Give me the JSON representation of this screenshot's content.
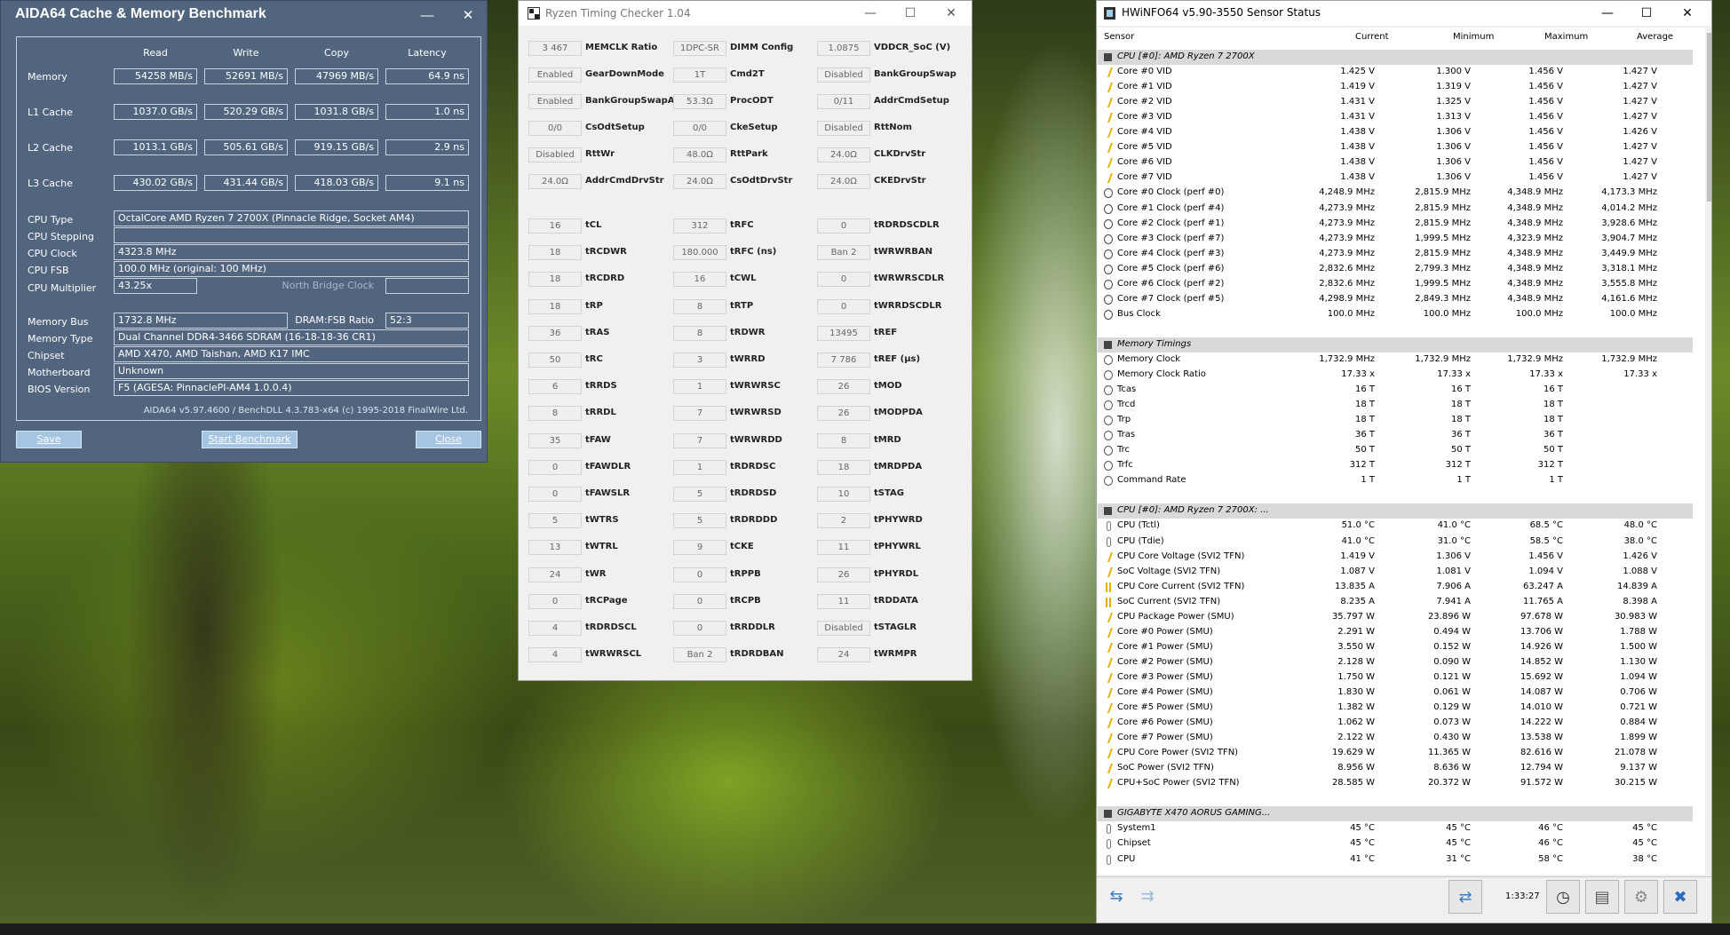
{
  "aida": {
    "title": "AIDA64 Cache & Memory Benchmark",
    "columns": [
      "Read",
      "Write",
      "Copy",
      "Latency"
    ],
    "rows": [
      {
        "label": "Memory",
        "values": [
          "54258 MB/s",
          "52691 MB/s",
          "47969 MB/s",
          "64.9 ns"
        ]
      },
      {
        "label": "L1 Cache",
        "values": [
          "1037.0 GB/s",
          "520.29 GB/s",
          "1031.8 GB/s",
          "1.0 ns"
        ]
      },
      {
        "label": "L2 Cache",
        "values": [
          "1013.1 GB/s",
          "505.61 GB/s",
          "919.15 GB/s",
          "2.9 ns"
        ]
      },
      {
        "label": "L3 Cache",
        "values": [
          "430.02 GB/s",
          "431.44 GB/s",
          "418.03 GB/s",
          "9.1 ns"
        ]
      }
    ],
    "cpu_type_label": "CPU Type",
    "cpu_type": "OctalCore AMD Ryzen 7 2700X  (Pinnacle Ridge, Socket AM4)",
    "cpu_stepping_label": "CPU Stepping",
    "cpu_stepping": "",
    "cpu_clock_label": "CPU Clock",
    "cpu_clock": "4323.8 MHz",
    "cpu_fsb_label": "CPU FSB",
    "cpu_fsb": "100.0 MHz  (original: 100 MHz)",
    "cpu_multiplier_label": "CPU Multiplier",
    "cpu_multiplier": "43.25x",
    "nb_clock_label": "North Bridge Clock",
    "nb_clock": "",
    "memory_bus_label": "Memory Bus",
    "memory_bus": "1732.8 MHz",
    "dram_fsb_label": "DRAM:FSB Ratio",
    "dram_fsb": "52:3",
    "memory_type_label": "Memory Type",
    "memory_type": "Dual Channel DDR4-3466 SDRAM  (16-18-18-36 CR1)",
    "chipset_label": "Chipset",
    "chipset": "AMD X470, AMD Taishan, AMD K17 IMC",
    "motherboard_label": "Motherboard",
    "motherboard": "Unknown",
    "bios_label": "BIOS Version",
    "bios": "F5  (AGESA: PinnaclePI-AM4 1.0.0.4)",
    "footer": "AIDA64 v5.97.4600 / BenchDLL 4.3.783-x64  (c) 1995-2018 FinalWire Ltd.",
    "save_label": "Save",
    "start_label": "Start Benchmark",
    "close_label": "Close"
  },
  "rtc": {
    "title": "Ryzen Timing Checker 1.04",
    "col1": [
      {
        "v": "3 467",
        "n": "MEMCLK Ratio"
      },
      {
        "v": "Enabled",
        "n": "GearDownMode"
      },
      {
        "v": "Enabled",
        "n": "BankGroupSwapAlt"
      },
      {
        "v": "0/0",
        "n": "CsOdtSetup"
      },
      {
        "v": "Disabled",
        "n": "RttWr"
      },
      {
        "v": "24.0Ω",
        "n": "AddrCmdDrvStr"
      },
      {
        "v": "16",
        "n": "tCL"
      },
      {
        "v": "18",
        "n": "tRCDWR"
      },
      {
        "v": "18",
        "n": "tRCDRD"
      },
      {
        "v": "18",
        "n": "tRP"
      },
      {
        "v": "36",
        "n": "tRAS"
      },
      {
        "v": "50",
        "n": "tRC"
      },
      {
        "v": "6",
        "n": "tRRDS"
      },
      {
        "v": "8",
        "n": "tRRDL"
      },
      {
        "v": "35",
        "n": "tFAW"
      },
      {
        "v": "0",
        "n": "tFAWDLR"
      },
      {
        "v": "0",
        "n": "tFAWSLR"
      },
      {
        "v": "5",
        "n": "tWTRS"
      },
      {
        "v": "13",
        "n": "tWTRL"
      },
      {
        "v": "24",
        "n": "tWR"
      },
      {
        "v": "0",
        "n": "tRCPage"
      },
      {
        "v": "4",
        "n": "tRDRDSCL"
      },
      {
        "v": "4",
        "n": "tWRWRSCL"
      }
    ],
    "col2": [
      {
        "v": "1DPC-SR",
        "n": "DIMM Config"
      },
      {
        "v": "1T",
        "n": "Cmd2T"
      },
      {
        "v": "53.3Ω",
        "n": "ProcODT"
      },
      {
        "v": "0/0",
        "n": "CkeSetup"
      },
      {
        "v": "48.0Ω",
        "n": "RttPark"
      },
      {
        "v": "24.0Ω",
        "n": "CsOdtDrvStr"
      },
      {
        "v": "312",
        "n": "tRFC"
      },
      {
        "v": "180.000",
        "n": "tRFC (ns)"
      },
      {
        "v": "16",
        "n": "tCWL"
      },
      {
        "v": "8",
        "n": "tRTP"
      },
      {
        "v": "8",
        "n": "tRDWR"
      },
      {
        "v": "3",
        "n": "tWRRD"
      },
      {
        "v": "1",
        "n": "tWRWRSC"
      },
      {
        "v": "7",
        "n": "tWRWRSD"
      },
      {
        "v": "7",
        "n": "tWRWRDD"
      },
      {
        "v": "1",
        "n": "tRDRDSC"
      },
      {
        "v": "5",
        "n": "tRDRDSD"
      },
      {
        "v": "5",
        "n": "tRDRDDD"
      },
      {
        "v": "9",
        "n": "tCKE"
      },
      {
        "v": "0",
        "n": "tRPPB"
      },
      {
        "v": "0",
        "n": "tRCPB"
      },
      {
        "v": "0",
        "n": "tRRDDLR"
      },
      {
        "v": "Ban 2",
        "n": "tRDRDBAN"
      }
    ],
    "col3": [
      {
        "v": "1.0875",
        "n": "VDDCR_SoC (V)"
      },
      {
        "v": "Disabled",
        "n": "BankGroupSwap"
      },
      {
        "v": "0/11",
        "n": "AddrCmdSetup"
      },
      {
        "v": "Disabled",
        "n": "RttNom"
      },
      {
        "v": "24.0Ω",
        "n": "CLKDrvStr"
      },
      {
        "v": "24.0Ω",
        "n": "CKEDrvStr"
      },
      {
        "v": "0",
        "n": "tRDRDSCDLR"
      },
      {
        "v": "Ban 2",
        "n": "tWRWRBAN"
      },
      {
        "v": "0",
        "n": "tWRWRSCDLR"
      },
      {
        "v": "0",
        "n": "tWRRDSCDLR"
      },
      {
        "v": "13495",
        "n": "tREF"
      },
      {
        "v": "7 786",
        "n": "tREF (µs)"
      },
      {
        "v": "26",
        "n": "tMOD"
      },
      {
        "v": "26",
        "n": "tMODPDA"
      },
      {
        "v": "8",
        "n": "tMRD"
      },
      {
        "v": "18",
        "n": "tMRDPDA"
      },
      {
        "v": "10",
        "n": "tSTAG"
      },
      {
        "v": "2",
        "n": "tPHYWRD"
      },
      {
        "v": "11",
        "n": "tPHYWRL"
      },
      {
        "v": "26",
        "n": "tPHYRDL"
      },
      {
        "v": "11",
        "n": "tRDDATA"
      },
      {
        "v": "Disabled",
        "n": "tSTAGLR"
      },
      {
        "v": "24",
        "n": "tWRMPR"
      }
    ]
  },
  "hw": {
    "title": "HWiNFO64 v5.90-3550 Sensor Status",
    "headers": [
      "Sensor",
      "Current",
      "Minimum",
      "Maximum",
      "Average"
    ],
    "rows": [
      {
        "s": 1,
        "ic": "chip",
        "n": "CPU [#0]: AMD Ryzen 7 2700X",
        "v": [
          "",
          "",
          "",
          ""
        ]
      },
      {
        "ic": "volt",
        "n": "Core #0 VID",
        "v": [
          "1.425 V",
          "1.300 V",
          "1.456 V",
          "1.427 V"
        ]
      },
      {
        "ic": "volt",
        "n": "Core #1 VID",
        "v": [
          "1.419 V",
          "1.319 V",
          "1.456 V",
          "1.427 V"
        ]
      },
      {
        "ic": "volt",
        "n": "Core #2 VID",
        "v": [
          "1.431 V",
          "1.325 V",
          "1.456 V",
          "1.427 V"
        ]
      },
      {
        "ic": "volt",
        "n": "Core #3 VID",
        "v": [
          "1.431 V",
          "1.313 V",
          "1.456 V",
          "1.427 V"
        ]
      },
      {
        "ic": "volt",
        "n": "Core #4 VID",
        "v": [
          "1.438 V",
          "1.306 V",
          "1.456 V",
          "1.426 V"
        ]
      },
      {
        "ic": "volt",
        "n": "Core #5 VID",
        "v": [
          "1.438 V",
          "1.306 V",
          "1.456 V",
          "1.427 V"
        ]
      },
      {
        "ic": "volt",
        "n": "Core #6 VID",
        "v": [
          "1.438 V",
          "1.306 V",
          "1.456 V",
          "1.427 V"
        ]
      },
      {
        "ic": "volt",
        "n": "Core #7 VID",
        "v": [
          "1.438 V",
          "1.306 V",
          "1.456 V",
          "1.427 V"
        ]
      },
      {
        "ic": "clk",
        "n": "Core #0 Clock (perf #0)",
        "v": [
          "4,248.9 MHz",
          "2,815.9 MHz",
          "4,348.9 MHz",
          "4,173.3 MHz"
        ]
      },
      {
        "ic": "clk",
        "n": "Core #1 Clock (perf #4)",
        "v": [
          "4,273.9 MHz",
          "2,815.9 MHz",
          "4,348.9 MHz",
          "4,014.2 MHz"
        ]
      },
      {
        "ic": "clk",
        "n": "Core #2 Clock (perf #1)",
        "v": [
          "4,273.9 MHz",
          "2,815.9 MHz",
          "4,348.9 MHz",
          "3,928.6 MHz"
        ]
      },
      {
        "ic": "clk",
        "n": "Core #3 Clock (perf #7)",
        "v": [
          "4,273.9 MHz",
          "1,999.5 MHz",
          "4,323.9 MHz",
          "3,904.7 MHz"
        ]
      },
      {
        "ic": "clk",
        "n": "Core #4 Clock (perf #3)",
        "v": [
          "4,273.9 MHz",
          "2,815.9 MHz",
          "4,348.9 MHz",
          "3,449.9 MHz"
        ]
      },
      {
        "ic": "clk",
        "n": "Core #5 Clock (perf #6)",
        "v": [
          "2,832.6 MHz",
          "2,799.3 MHz",
          "4,348.9 MHz",
          "3,318.1 MHz"
        ]
      },
      {
        "ic": "clk",
        "n": "Core #6 Clock (perf #2)",
        "v": [
          "2,832.6 MHz",
          "1,999.5 MHz",
          "4,348.9 MHz",
          "3,555.8 MHz"
        ]
      },
      {
        "ic": "clk",
        "n": "Core #7 Clock (perf #5)",
        "v": [
          "4,298.9 MHz",
          "2,849.3 MHz",
          "4,348.9 MHz",
          "4,161.6 MHz"
        ]
      },
      {
        "ic": "clk",
        "n": "Bus Clock",
        "v": [
          "100.0 MHz",
          "100.0 MHz",
          "100.0 MHz",
          "100.0 MHz"
        ]
      },
      {
        "gap": 1
      },
      {
        "s": 1,
        "ic": "chip",
        "n": "Memory Timings",
        "v": [
          "",
          "",
          "",
          ""
        ]
      },
      {
        "ic": "tim",
        "n": "Memory Clock",
        "v": [
          "1,732.9 MHz",
          "1,732.9 MHz",
          "1,732.9 MHz",
          "1,732.9 MHz"
        ]
      },
      {
        "ic": "tim",
        "n": "Memory Clock Ratio",
        "v": [
          "17.33 x",
          "17.33 x",
          "17.33 x",
          "17.33 x"
        ]
      },
      {
        "ic": "tim",
        "n": "Tcas",
        "v": [
          "16 T",
          "16 T",
          "16 T",
          ""
        ]
      },
      {
        "ic": "tim",
        "n": "Trcd",
        "v": [
          "18 T",
          "18 T",
          "18 T",
          ""
        ]
      },
      {
        "ic": "tim",
        "n": "Trp",
        "v": [
          "18 T",
          "18 T",
          "18 T",
          ""
        ]
      },
      {
        "ic": "tim",
        "n": "Tras",
        "v": [
          "36 T",
          "36 T",
          "36 T",
          ""
        ]
      },
      {
        "ic": "tim",
        "n": "Trc",
        "v": [
          "50 T",
          "50 T",
          "50 T",
          ""
        ]
      },
      {
        "ic": "tim",
        "n": "Trfc",
        "v": [
          "312 T",
          "312 T",
          "312 T",
          ""
        ]
      },
      {
        "ic": "tim",
        "n": "Command Rate",
        "v": [
          "1 T",
          "1 T",
          "1 T",
          ""
        ]
      },
      {
        "gap": 1
      },
      {
        "s": 1,
        "ic": "chip",
        "n": "CPU [#0]: AMD Ryzen 7 2700X: ...",
        "v": [
          "",
          "",
          "",
          ""
        ]
      },
      {
        "ic": "temp",
        "n": "CPU (Tctl)",
        "v": [
          "51.0 °C",
          "41.0 °C",
          "68.5 °C",
          "48.0 °C"
        ]
      },
      {
        "ic": "temp",
        "n": "CPU (Tdie)",
        "v": [
          "41.0 °C",
          "31.0 °C",
          "58.5 °C",
          "38.0 °C"
        ]
      },
      {
        "ic": "volt",
        "n": "CPU Core Voltage (SVI2 TFN)",
        "v": [
          "1.419 V",
          "1.306 V",
          "1.456 V",
          "1.426 V"
        ]
      },
      {
        "ic": "volt",
        "n": "SoC Voltage (SVI2 TFN)",
        "v": [
          "1.087 V",
          "1.081 V",
          "1.094 V",
          "1.088 V"
        ]
      },
      {
        "ic": "cur",
        "n": "CPU Core Current (SVI2 TFN)",
        "v": [
          "13.835 A",
          "7.906 A",
          "63.247 A",
          "14.839 A"
        ]
      },
      {
        "ic": "cur",
        "n": "SoC Current (SVI2 TFN)",
        "v": [
          "8.235 A",
          "7.941 A",
          "11.765 A",
          "8.398 A"
        ]
      },
      {
        "ic": "pwr",
        "n": "CPU Package Power (SMU)",
        "v": [
          "35.797 W",
          "23.896 W",
          "97.678 W",
          "30.983 W"
        ]
      },
      {
        "ic": "pwr",
        "n": "Core #0 Power (SMU)",
        "v": [
          "2.291 W",
          "0.494 W",
          "13.706 W",
          "1.788 W"
        ]
      },
      {
        "ic": "pwr",
        "n": "Core #1 Power (SMU)",
        "v": [
          "3.550 W",
          "0.152 W",
          "14.926 W",
          "1.500 W"
        ]
      },
      {
        "ic": "pwr",
        "n": "Core #2 Power (SMU)",
        "v": [
          "2.128 W",
          "0.090 W",
          "14.852 W",
          "1.130 W"
        ]
      },
      {
        "ic": "pwr",
        "n": "Core #3 Power (SMU)",
        "v": [
          "1.750 W",
          "0.121 W",
          "15.692 W",
          "1.094 W"
        ]
      },
      {
        "ic": "pwr",
        "n": "Core #4 Power (SMU)",
        "v": [
          "1.830 W",
          "0.061 W",
          "14.087 W",
          "0.706 W"
        ]
      },
      {
        "ic": "pwr",
        "n": "Core #5 Power (SMU)",
        "v": [
          "1.382 W",
          "0.129 W",
          "14.010 W",
          "0.721 W"
        ]
      },
      {
        "ic": "pwr",
        "n": "Core #6 Power (SMU)",
        "v": [
          "1.062 W",
          "0.073 W",
          "14.222 W",
          "0.884 W"
        ]
      },
      {
        "ic": "pwr",
        "n": "Core #7 Power (SMU)",
        "v": [
          "2.122 W",
          "0.430 W",
          "13.538 W",
          "1.899 W"
        ]
      },
      {
        "ic": "pwr",
        "n": "CPU Core Power (SVI2 TFN)",
        "v": [
          "19.629 W",
          "11.365 W",
          "82.616 W",
          "21.078 W"
        ]
      },
      {
        "ic": "pwr",
        "n": "SoC Power (SVI2 TFN)",
        "v": [
          "8.956 W",
          "8.636 W",
          "12.794 W",
          "9.137 W"
        ]
      },
      {
        "ic": "pwr",
        "n": "CPU+SoC Power (SVI2 TFN)",
        "v": [
          "28.585 W",
          "20.372 W",
          "91.572 W",
          "30.215 W"
        ]
      },
      {
        "gap": 1
      },
      {
        "s": 1,
        "ic": "chip",
        "n": "GIGABYTE X470 AORUS GAMING...",
        "v": [
          "",
          "",
          "",
          ""
        ]
      },
      {
        "ic": "temp",
        "n": "System1",
        "v": [
          "45 °C",
          "45 °C",
          "46 °C",
          "45 °C"
        ]
      },
      {
        "ic": "temp",
        "n": "Chipset",
        "v": [
          "45 °C",
          "45 °C",
          "46 °C",
          "45 °C"
        ]
      },
      {
        "ic": "temp",
        "n": "CPU",
        "v": [
          "41 °C",
          "31 °C",
          "58 °C",
          "38 °C"
        ]
      }
    ],
    "time": "1:33:27"
  }
}
